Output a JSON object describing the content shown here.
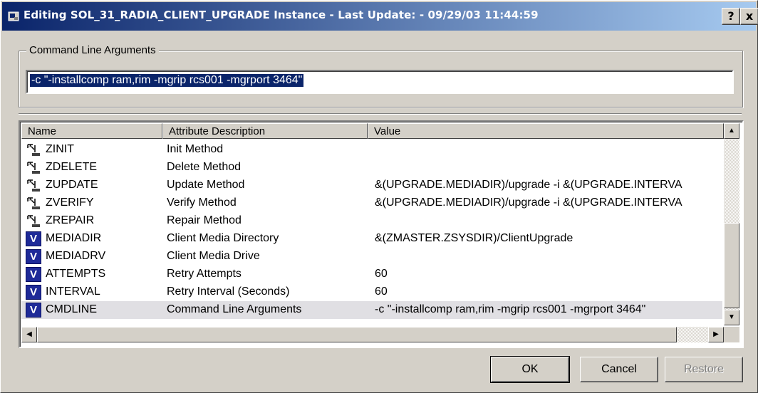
{
  "window": {
    "title": "Editing SOL_31_RADIA_CLIENT_UPGRADE Instance - Last Update: - 09/29/03 11:44:59",
    "help_label": "?",
    "close_label": "x"
  },
  "command_group": {
    "label": "Command Line Arguments",
    "value": "-c \"-installcomp ram,rim -mgrip rcs001 -mgrport 3464\""
  },
  "table": {
    "columns": [
      "Name",
      "Attribute Description",
      "Value"
    ],
    "rows": [
      {
        "icon": "method-icon",
        "name": "ZINIT",
        "desc": "Init Method",
        "value": ""
      },
      {
        "icon": "method-icon",
        "name": "ZDELETE",
        "desc": "Delete Method",
        "value": ""
      },
      {
        "icon": "method-icon",
        "name": "ZUPDATE",
        "desc": "Update Method",
        "value": "&(UPGRADE.MEDIADIR)/upgrade  -i &(UPGRADE.INTERVA"
      },
      {
        "icon": "method-icon",
        "name": "ZVERIFY",
        "desc": "Verify Method",
        "value": "&(UPGRADE.MEDIADIR)/upgrade  -i &(UPGRADE.INTERVA"
      },
      {
        "icon": "method-icon",
        "name": "ZREPAIR",
        "desc": "Repair Method",
        "value": ""
      },
      {
        "icon": "variable-icon",
        "name": "MEDIADIR",
        "desc": "Client Media Directory",
        "value": "&(ZMASTER.ZSYSDIR)/ClientUpgrade"
      },
      {
        "icon": "variable-icon",
        "name": "MEDIADRV",
        "desc": "Client Media Drive",
        "value": ""
      },
      {
        "icon": "variable-icon",
        "name": "ATTEMPTS",
        "desc": "Retry Attempts",
        "value": "60"
      },
      {
        "icon": "variable-icon",
        "name": "INTERVAL",
        "desc": "Retry Interval (Seconds)",
        "value": "60"
      },
      {
        "icon": "variable-icon",
        "name": "CMDLINE",
        "desc": "Command Line Arguments",
        "value": "-c \"-installcomp ram,rim -mgrip rcs001 -mgrport 3464\"",
        "selected": true
      }
    ],
    "variable_icon_letter": "V"
  },
  "buttons": {
    "ok": "OK",
    "cancel": "Cancel",
    "restore": "Restore"
  },
  "colors": {
    "title_gradient_start": "#0a246a",
    "title_gradient_end": "#a6caf0",
    "variable_icon_bg": "#1e2a98",
    "selection_bg": "#0a246a"
  }
}
